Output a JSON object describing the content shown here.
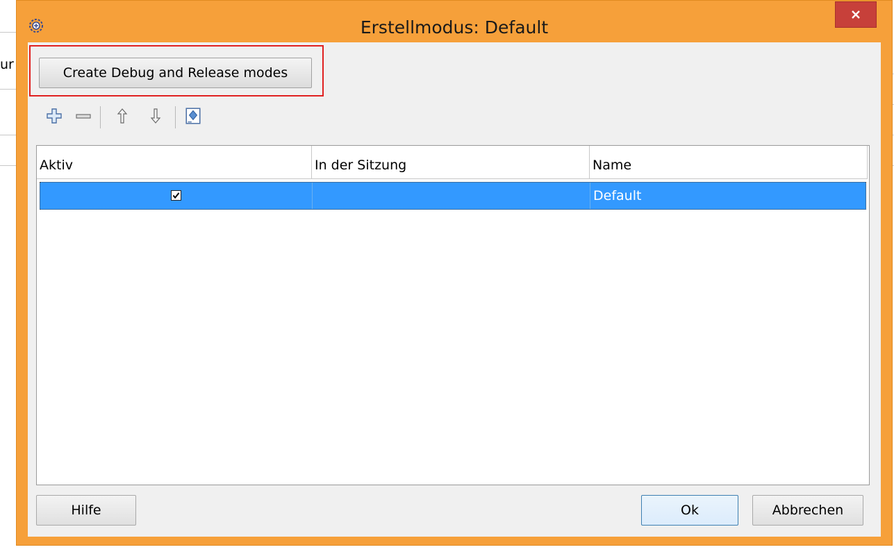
{
  "background": {
    "partial_text": "ur"
  },
  "dialog": {
    "title": "Erstellmodus: Default",
    "icon": "app-gear-icon",
    "close_icon": "close-icon",
    "colors": {
      "frame": "#f6a03a",
      "close": "#c7403a",
      "selection": "#3399ff"
    }
  },
  "toolbar": {
    "create_modes_label": "Create Debug and Release modes",
    "icons": [
      "add-icon",
      "remove-icon",
      "move-up-icon",
      "move-down-icon",
      "edit-mode-icon"
    ]
  },
  "table": {
    "headers": [
      "Aktiv",
      "In der Sitzung",
      "Name"
    ],
    "rows": [
      {
        "aktiv": true,
        "in_der_sitzung": "",
        "name": "Default"
      }
    ]
  },
  "footer": {
    "help_label": "Hilfe",
    "ok_label": "Ok",
    "cancel_label": "Abbrechen"
  }
}
